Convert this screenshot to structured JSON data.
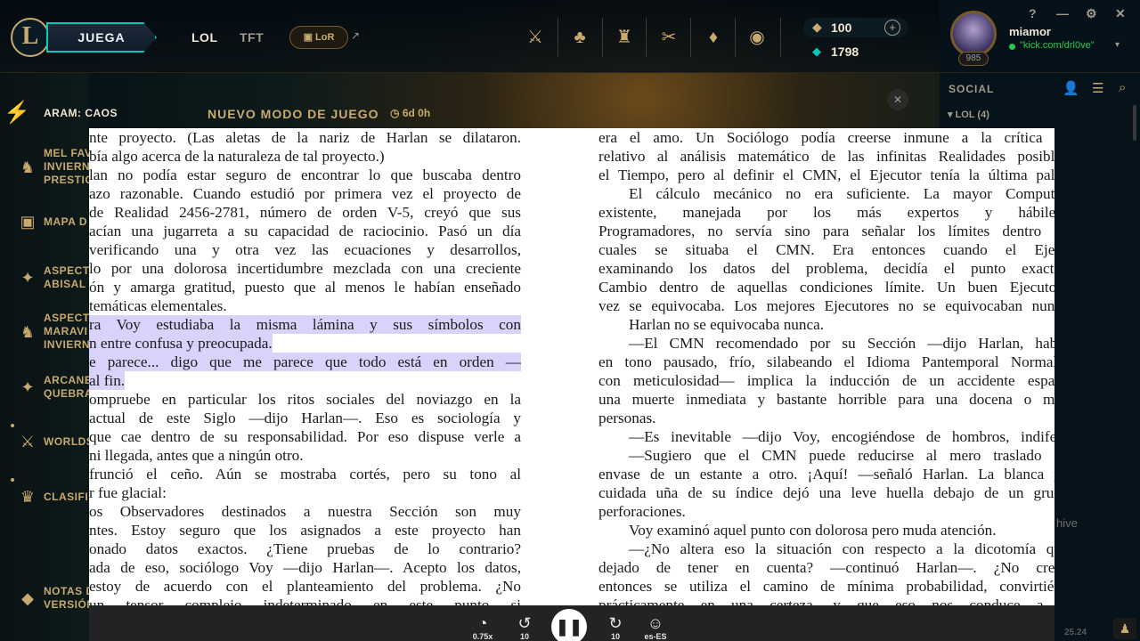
{
  "topbar": {
    "play_label": "JUEGA",
    "tab_lol": "LOL",
    "tab_tft": "TFT",
    "lor_label": "LoR",
    "rp_value": "100",
    "be_value": "1798"
  },
  "profile": {
    "username": "miamor",
    "status": "\"kick.com/drl0ve\"",
    "level": "985"
  },
  "window_controls": {
    "help": "?",
    "minimize": "—",
    "settings": "⚙",
    "close": "✕"
  },
  "mode_banner": {
    "mode_name": "ARAM: CAOS",
    "new_mode": "NUEVO MODO DE JUEGO",
    "timer": "6d 0h"
  },
  "sidebar": {
    "items": [
      {
        "label": "MEL FAV\nINVIERN\nPRESTIC",
        "icon": "mask-icon"
      },
      {
        "label": "MAPA D",
        "icon": "map-icon"
      },
      {
        "label": "ASPECTO\nABISAL",
        "icon": "star-icon"
      },
      {
        "label": "ASPECTO\nMARAVI\nINVIERN",
        "icon": "mask-icon"
      },
      {
        "label": "ARCANE\nQUEBRA",
        "icon": "star-icon"
      },
      {
        "label": "WORLDS",
        "icon": "worlds-icon"
      },
      {
        "label": "CLASIFI",
        "icon": "ranked-icon"
      },
      {
        "label": "NOTAS D\nVERSIÓN",
        "icon": "diamond-icon"
      }
    ]
  },
  "social": {
    "title": "SOCIAL",
    "group": "LOL (4)",
    "archive_fragment": "hive",
    "version": "25.24"
  },
  "document": {
    "left_lines": [
      "nte proyecto. (Las aletas de la nariz de Harlan se dilataron.",
      "bía algo acerca de la naturaleza de tal proyecto.)",
      "lan no podía estar seguro de encontrar lo que buscaba dentro",
      "azo razonable. Cuando estudió por primera vez el proyecto de",
      "de Realidad 2456-2781, número de orden V-5, creyó que sus",
      "acían una jugarreta a su capacidad de raciocinio. Pasó un día",
      "verificando una y otra vez las ecuaciones y desarrollos,",
      "lo por una dolorosa incertidumbre mezclada con una creciente",
      "ón y amarga gratitud, puesto que al menos le habían enseñado",
      "temáticas elementales.",
      "ra Voy estudiaba la misma lámina y sus símbolos con",
      "n entre confusa y preocupada.",
      "e parece... digo que me parece que todo está en orden —",
      "al fin.",
      "ompruebe en particular los ritos sociales del noviazgo en la",
      " actual de este Siglo —dijo Harlan—. Eso es sociología y",
      " que cae dentro de su responsabilidad. Por eso dispuse verle a",
      "ni llegada, antes que a ningún otro.",
      " frunció el ceño. Aún se mostraba cortés, pero su tono al",
      "r fue glacial:",
      "os Observadores destinados a nuestra Sección son muy",
      "ntes. Estoy seguro que los asignados a este proyecto han",
      "onado datos exactos. ¿Tiene pruebas de lo contrario?",
      "ada de eso, sociólogo Voy —dijo Harlan—. Acepto los datos,",
      " estoy de acuerdo con el planteamiento del problema. ¿No",
      "un tensor complejo indeterminado en este punto si"
    ],
    "right_lines": [
      "era el amo. Un Sociólogo podía creerse inmune a la crítica e",
      "relativo al análisis matemático de las infinitas Realidades posible",
      "el Tiempo, pero al definir el CMN, el Ejecutor tenía la última pala",
      "El cálculo mecánico no era suficiente. La mayor Computa",
      "existente, manejada por los más expertos y hábiles",
      "Programadores, no servía sino para señalar los límites dentro d",
      "cuales se situaba el CMN. Era entonces cuando el Ejec",
      "examinando los datos del problema, decidía el punto exacto",
      "Cambio dentro de aquellas condiciones límite. Un buen Ejecutor",
      "vez se equivocaba. Los mejores Ejecutores no se equivocaban nunc",
      "Harlan no se equivocaba nunca.",
      "—El CMN recomendado por su Sección —dijo Harlan, habl",
      "en tono pausado, frío, silabeando el Idioma Pantemporal Normali",
      "con meticulosidad— implica la inducción de un accidente espac",
      "una muerte inmediata y bastante horrible para una docena o ma",
      "personas.",
      "—Es inevitable —dijo Voy, encogiéndose de hombros, indifer",
      "—Sugiero que el CMN puede reducirse al mero traslado d",
      "envase de un estante a otro. ¡Aquí! —señaló Harlan. La blanca y",
      "cuidada uña de su índice dejó una leve huella debajo de un grup",
      "perforaciones.",
      "Voy examinó aquel punto con dolorosa pero muda atención.",
      "—¿No altera eso la situación con respecto a la dicotomía qu",
      "dejado de tener en cuenta? —continuó Harlan—. ¿No cree",
      "entonces se utiliza el camino de mínima probabilidad, convirtién",
      "prácticamente en una certeza, y que eso nos conduce a...?"
    ]
  },
  "player": {
    "speed_label": "0.75x",
    "rewind_label": "10",
    "forward_label": "10",
    "lang_label": "es-ES"
  }
}
